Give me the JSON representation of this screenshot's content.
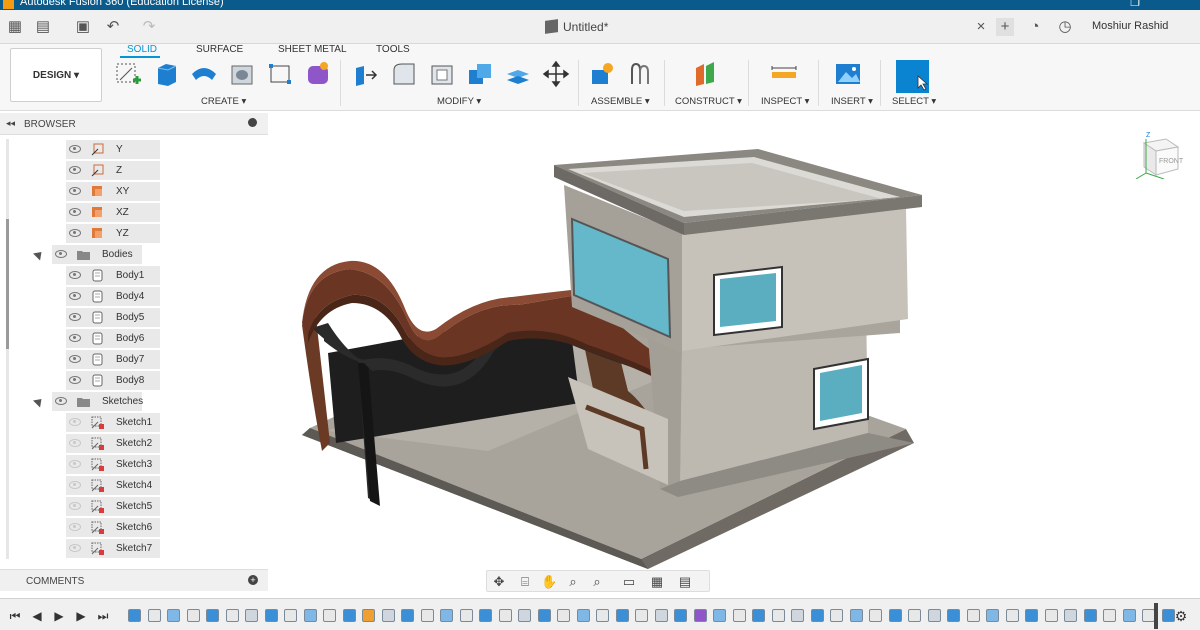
{
  "app": {
    "window_title": "Autodesk Fusion 360 (Education License)",
    "document_title": "Untitled*",
    "user_name": "Moshiur Rashid"
  },
  "toolbar": {
    "workspace_label": "DESIGN ▾",
    "tabs": [
      {
        "label": "SOLID",
        "active": true
      },
      {
        "label": "SURFACE",
        "active": false
      },
      {
        "label": "SHEET METAL",
        "active": false
      },
      {
        "label": "TOOLS",
        "active": false
      }
    ],
    "groups": [
      {
        "label": "CREATE ▾",
        "tools": [
          "create-sketch-icon",
          "extrude-icon",
          "revolve-icon",
          "hole-icon",
          "rectangle-icon",
          "form-icon"
        ]
      },
      {
        "label": "MODIFY ▾",
        "tools": [
          "press-pull-icon",
          "fillet-icon",
          "shell-icon",
          "combine-icon",
          "offset-face-icon",
          "move-icon"
        ]
      },
      {
        "label": "ASSEMBLE ▾",
        "tools": [
          "new-component-icon",
          "joint-icon"
        ]
      },
      {
        "label": "CONSTRUCT ▾",
        "tools": [
          "offset-plane-icon"
        ]
      },
      {
        "label": "INSPECT ▾",
        "tools": [
          "measure-icon"
        ]
      },
      {
        "label": "INSERT ▾",
        "tools": [
          "insert-image-icon"
        ]
      },
      {
        "label": "SELECT ▾",
        "tools": [
          "select-icon"
        ]
      }
    ],
    "accent_color": "#0696d7"
  },
  "browser": {
    "title": "BROWSER",
    "nodes": [
      {
        "label": "Y",
        "type": "axis",
        "visible": true
      },
      {
        "label": "Z",
        "type": "axis",
        "visible": true
      },
      {
        "label": "XY",
        "type": "plane",
        "visible": true
      },
      {
        "label": "XZ",
        "type": "plane",
        "visible": true
      },
      {
        "label": "YZ",
        "type": "plane",
        "visible": true
      },
      {
        "label": "Bodies",
        "type": "folder",
        "visible": true
      },
      {
        "label": "Body1",
        "type": "body",
        "visible": true
      },
      {
        "label": "Body4",
        "type": "body",
        "visible": true
      },
      {
        "label": "Body5",
        "type": "body",
        "visible": true
      },
      {
        "label": "Body6",
        "type": "body",
        "visible": true
      },
      {
        "label": "Body7",
        "type": "body",
        "visible": true
      },
      {
        "label": "Body8",
        "type": "body",
        "visible": true
      },
      {
        "label": "Sketches",
        "type": "folder",
        "visible": true
      },
      {
        "label": "Sketch1",
        "type": "sketch",
        "visible": false
      },
      {
        "label": "Sketch2",
        "type": "sketch",
        "visible": false
      },
      {
        "label": "Sketch3",
        "type": "sketch",
        "visible": false
      },
      {
        "label": "Sketch4",
        "type": "sketch",
        "visible": false
      },
      {
        "label": "Sketch5",
        "type": "sketch",
        "visible": false
      },
      {
        "label": "Sketch6",
        "type": "sketch",
        "visible": false
      },
      {
        "label": "Sketch7",
        "type": "sketch",
        "visible": false
      }
    ]
  },
  "comments": {
    "title": "COMMENTS"
  },
  "viewcube": {
    "face_label": "FRONT",
    "axis_label": "Z"
  },
  "navbar": {
    "tools": [
      "orbit-icon",
      "look-at-icon",
      "pan-icon",
      "zoom-icon",
      "fit-icon",
      "display-settings-icon",
      "grid-icon",
      "viewports-icon"
    ]
  },
  "timeline": {
    "controls": [
      "first-icon",
      "previous-icon",
      "play-icon",
      "next-icon",
      "last-icon"
    ],
    "feature_count": 54
  }
}
